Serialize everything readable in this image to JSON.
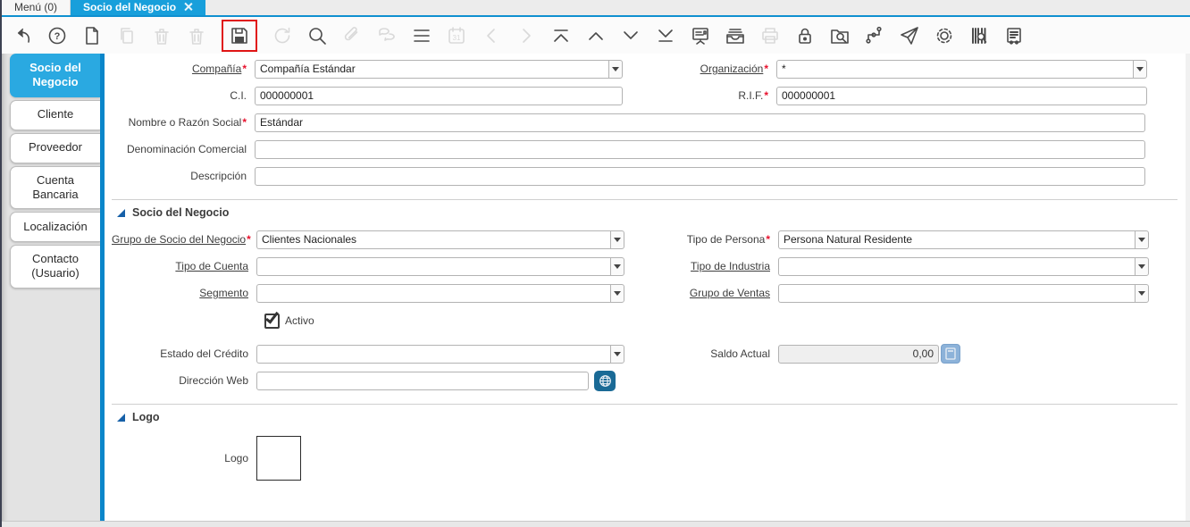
{
  "window": {
    "doc_tabs": [
      {
        "label": "Menú (0)",
        "active": false
      },
      {
        "label": "Socio del Negocio",
        "active": true
      }
    ]
  },
  "toolbar": {
    "icons": [
      {
        "name": "undo",
        "enabled": true
      },
      {
        "name": "help",
        "enabled": true
      },
      {
        "name": "new-record",
        "enabled": true
      },
      {
        "name": "copy-record",
        "enabled": false
      },
      {
        "name": "delete-record",
        "enabled": false
      },
      {
        "name": "delete-selection",
        "enabled": false
      },
      {
        "name": "save",
        "enabled": true,
        "highlighted_red_box": true
      },
      {
        "name": "refresh",
        "enabled": false
      },
      {
        "name": "find",
        "enabled": true
      },
      {
        "name": "attachment",
        "enabled": false
      },
      {
        "name": "chat",
        "enabled": false
      },
      {
        "name": "toggle-grid",
        "enabled": true
      },
      {
        "name": "calendar",
        "enabled": false
      },
      {
        "name": "parent-record",
        "enabled": false
      },
      {
        "name": "detail-record",
        "enabled": false
      },
      {
        "name": "first-record",
        "enabled": true
      },
      {
        "name": "previous-record",
        "enabled": true
      },
      {
        "name": "next-record",
        "enabled": true
      },
      {
        "name": "last-record",
        "enabled": true
      },
      {
        "name": "report",
        "enabled": true
      },
      {
        "name": "archive",
        "enabled": true
      },
      {
        "name": "print",
        "enabled": false
      },
      {
        "name": "lock",
        "enabled": true
      },
      {
        "name": "zoom-across",
        "enabled": true
      },
      {
        "name": "workflow",
        "enabled": true
      },
      {
        "name": "share",
        "enabled": true
      },
      {
        "name": "preferences",
        "enabled": true
      },
      {
        "name": "product-info",
        "enabled": true
      },
      {
        "name": "pos-receipt",
        "enabled": true
      }
    ],
    "help_glyph": "?",
    "calendar_day": "31"
  },
  "sidebar": {
    "tabs": [
      {
        "label": "Socio del Negocio",
        "active": true
      },
      {
        "label": "Cliente",
        "active": false
      },
      {
        "label": "Proveedor",
        "active": false
      },
      {
        "label": "Cuenta Bancaria",
        "active": false
      },
      {
        "label": "Localización",
        "active": false
      },
      {
        "label": "Contacto (Usuario)",
        "active": false
      }
    ]
  },
  "form": {
    "compania": {
      "label": "Compañía",
      "req": "*",
      "value": "Compañía Estándar"
    },
    "organizacion": {
      "label": "Organización",
      "req": "*",
      "value": "*"
    },
    "ci": {
      "label": "C.I.",
      "value": "000000001"
    },
    "rif": {
      "label": "R.I.F.",
      "req": "*",
      "value": "000000001"
    },
    "nombre": {
      "label": "Nombre o Razón Social",
      "req": "*",
      "value": "Estándar"
    },
    "denominacion": {
      "label": "Denominación Comercial",
      "value": ""
    },
    "descripcion": {
      "label": "Descripción",
      "value": ""
    },
    "section_socio": {
      "title": "Socio del Negocio"
    },
    "grupo_socio": {
      "label": "Grupo de Socio del Negocio",
      "req": "*",
      "value": "Clientes Nacionales"
    },
    "tipo_persona": {
      "label": "Tipo de Persona",
      "req": "*",
      "value": "Persona Natural Residente"
    },
    "tipo_cuenta": {
      "label": "Tipo de Cuenta",
      "value": ""
    },
    "tipo_industria": {
      "label": "Tipo de Industria",
      "value": ""
    },
    "segmento": {
      "label": "Segmento",
      "value": ""
    },
    "grupo_ventas": {
      "label": "Grupo de Ventas",
      "value": ""
    },
    "activo": {
      "label": "Activo",
      "checked": true
    },
    "estado_credito": {
      "label": "Estado del Crédito",
      "value": ""
    },
    "saldo_actual": {
      "label": "Saldo Actual",
      "value": "0,00"
    },
    "direccion_web": {
      "label": "Dirección Web",
      "value": ""
    },
    "section_logo": {
      "title": "Logo"
    },
    "logo": {
      "label": "Logo"
    }
  }
}
